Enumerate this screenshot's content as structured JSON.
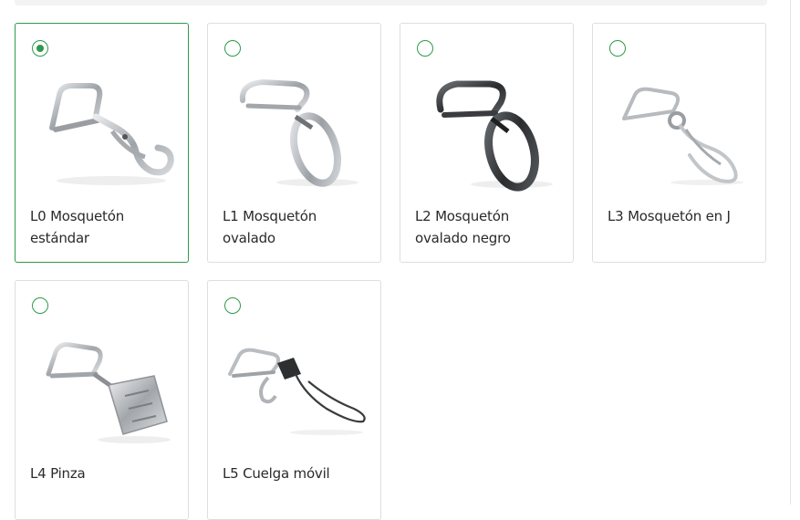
{
  "options": [
    {
      "label": "L0 Mosquetón estándar",
      "selected": true,
      "icon": "standard-snap-hook-icon"
    },
    {
      "label": "L1 Mosquetón ovalado",
      "selected": false,
      "icon": "oval-snap-hook-icon"
    },
    {
      "label": "L2 Mosquetón ovalado negro",
      "selected": false,
      "icon": "black-oval-snap-hook-icon"
    },
    {
      "label": "L3 Mosquetón en J",
      "selected": false,
      "icon": "j-hook-icon"
    },
    {
      "label": "L4 Pinza",
      "selected": false,
      "icon": "clip-icon"
    },
    {
      "label": "L5 Cuelga móvil",
      "selected": false,
      "icon": "phone-strap-icon"
    }
  ],
  "colors": {
    "accent": "#2e9a4a",
    "border": "#dedede",
    "metal": "#b8bcc0",
    "dark_metal": "#3d3f42"
  }
}
